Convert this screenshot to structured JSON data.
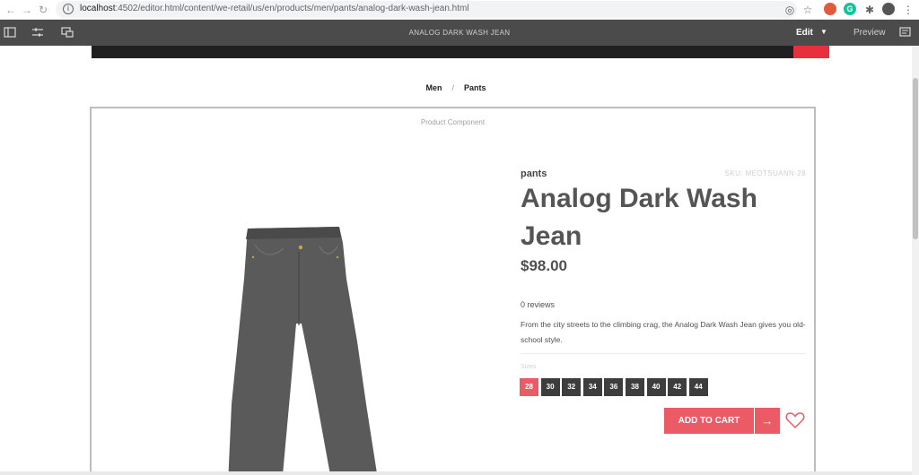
{
  "browser": {
    "url_host": "localhost",
    "url_path": ":4502/editor.html/content/we-retail/us/en/products/men/pants/analog-dark-wash-jean.html",
    "icons": [
      "back-icon",
      "forward-icon",
      "reload-icon",
      "info-icon",
      "location-icon",
      "star-icon",
      "extension-icon",
      "grammarly-icon",
      "puzzle-icon",
      "avatar",
      "menu-icon"
    ]
  },
  "editor": {
    "page_title": "ANALOG DARK WASH JEAN",
    "mode": "Edit",
    "preview_label": "Preview"
  },
  "breadcrumb": {
    "items": [
      "Men",
      "Pants"
    ],
    "separator": "/"
  },
  "component": {
    "label": "Product Component"
  },
  "product": {
    "category": "pants",
    "sku": "SKU: MEOTSUANN-28",
    "name": "Analog Dark Wash Jean",
    "price": "$98.00",
    "reviews": "0 reviews",
    "description": "From the city streets to the climbing crag, the Analog Dark Wash Jean gives you old-school style.",
    "sizes_label": "Sizes",
    "sizes": [
      "28",
      "30",
      "32",
      "34",
      "36",
      "38",
      "40",
      "42",
      "44"
    ],
    "selected_size": "28",
    "add_to_cart": "ADD TO CART"
  },
  "colors": {
    "accent": "#ec5b65",
    "toolbar": "#4b4b4b",
    "chip": "#3d3d3d",
    "text": "#505050"
  }
}
